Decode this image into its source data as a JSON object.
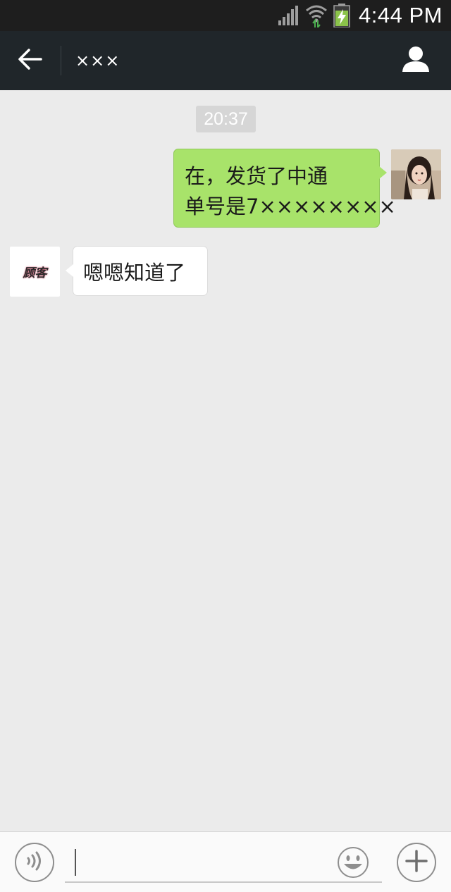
{
  "status_bar": {
    "time": "4:44 PM",
    "icons": [
      "signal-icon",
      "wifi-icon",
      "battery-charging-icon"
    ],
    "battery_color": "#8bc34a"
  },
  "header": {
    "back_icon": "arrow-left-icon",
    "contact_name": "×××",
    "profile_icon": "person-icon"
  },
  "chat": {
    "timestamp": "20:37",
    "messages": [
      {
        "direction": "sent",
        "lines": [
          "在，发货了中通",
          "单号是7××××××××"
        ],
        "avatar": "self-avatar-photo"
      },
      {
        "direction": "received",
        "text": "嗯嗯知道了",
        "avatar_text": "顾客"
      }
    ]
  },
  "input_bar": {
    "voice_icon": "voice-icon",
    "text_value": "",
    "emoji_icon": "smiley-icon",
    "add_icon": "plus-icon"
  },
  "colors": {
    "header_bg": "#20262a",
    "chat_bg": "#ebebeb",
    "sent_bubble": "#a8e36a",
    "received_bubble": "#ffffff"
  }
}
